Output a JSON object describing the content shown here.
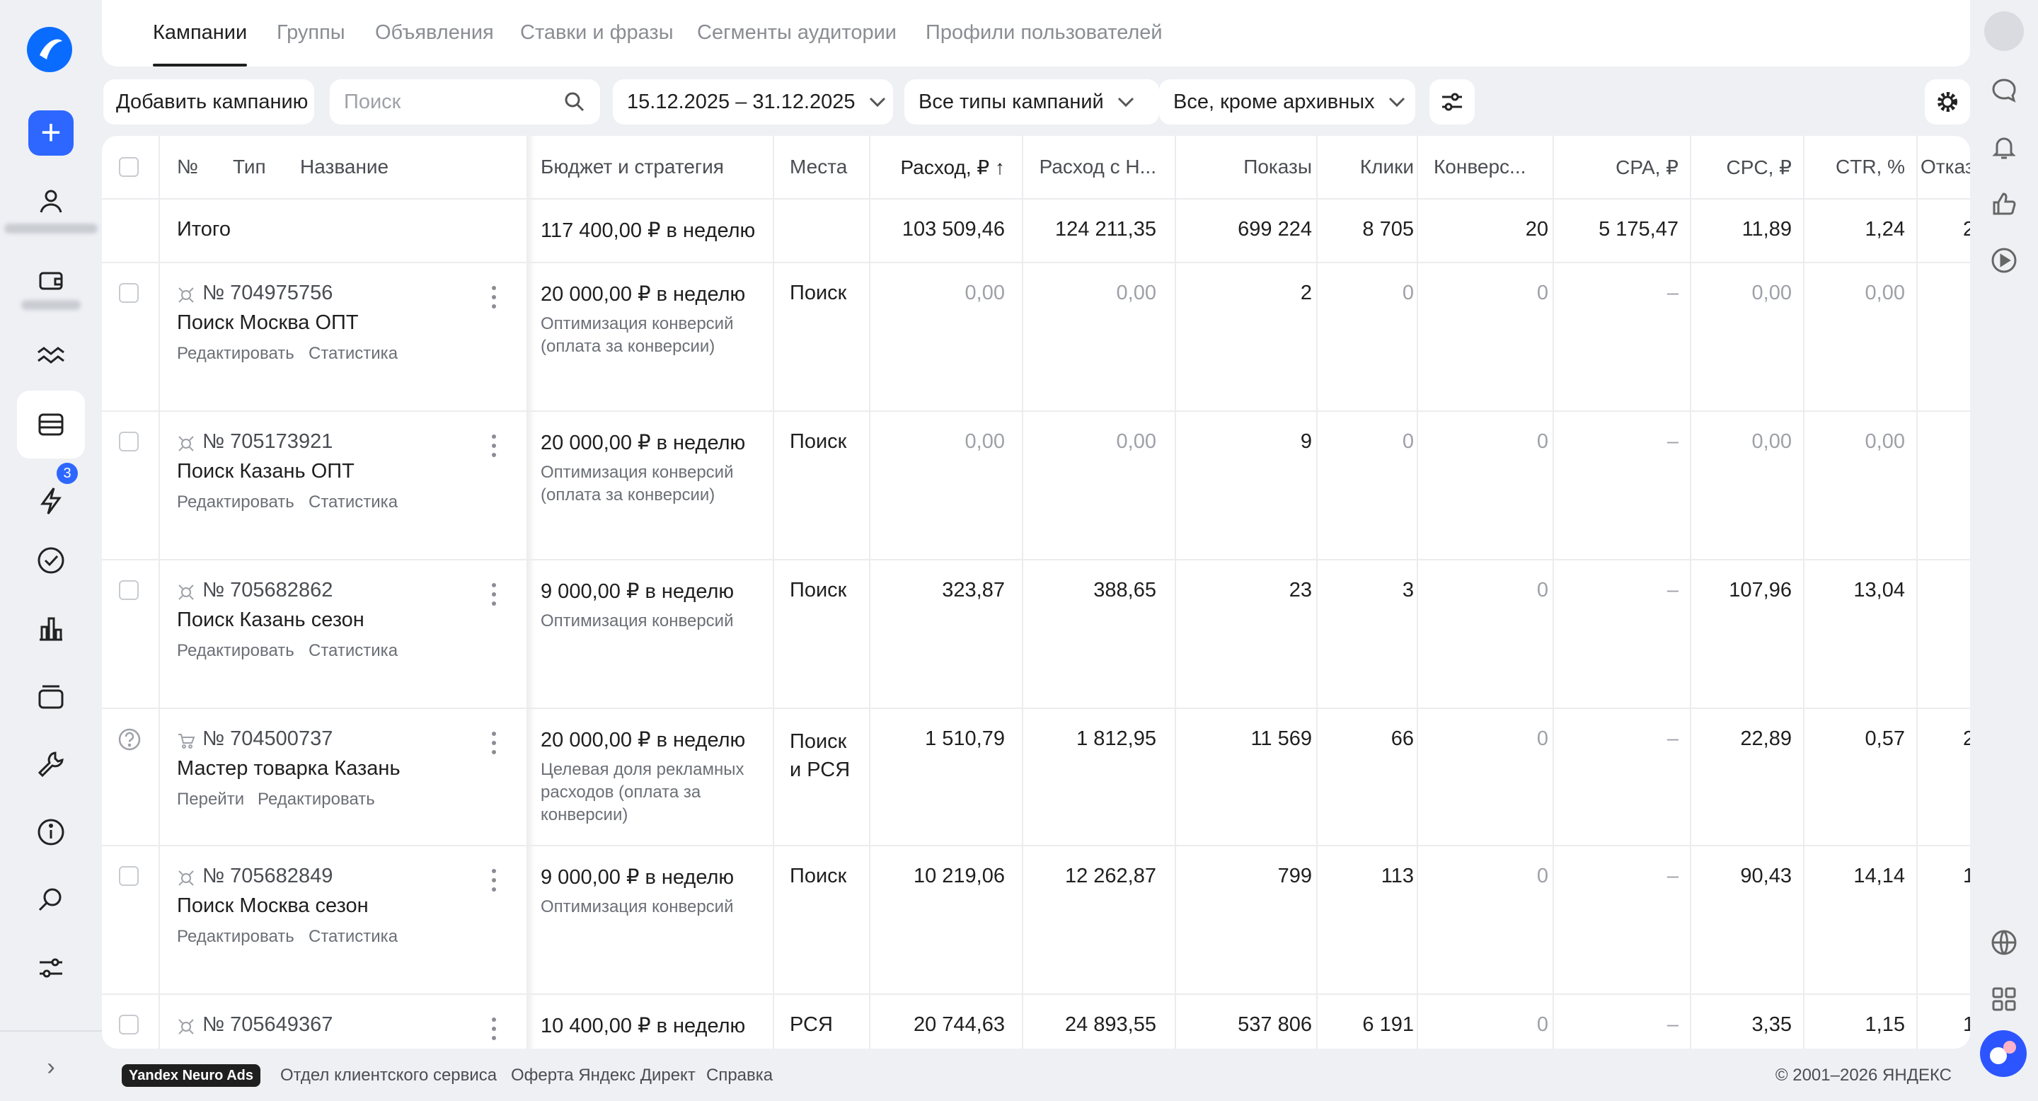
{
  "nav": {
    "tabs": [
      {
        "label": "Кампании",
        "active": true
      },
      {
        "label": "Группы"
      },
      {
        "label": "Объявления"
      },
      {
        "label": "Ставки и фразы"
      },
      {
        "label": "Сегменты аудитории"
      },
      {
        "label": "Профили пользователей"
      }
    ],
    "badge_count": "3"
  },
  "toolbar": {
    "add_label": "Добавить кампанию",
    "search_placeholder": "Поиск",
    "date_range": "15.12.2025 – 31.12.2025",
    "type_filter": "Все типы кампаний",
    "archive_filter": "Все, кроме архивных"
  },
  "table": {
    "headers": {
      "no": "№",
      "type": "Тип",
      "name": "Название",
      "budget": "Бюджет и стратегия",
      "places": "Места",
      "spend": "Расход, ₽ ↑",
      "spend_vat": "Расход с Н...",
      "impressions": "Показы",
      "clicks": "Клики",
      "conversions": "Конверс...",
      "cpa": "CPA, ₽",
      "cpc": "CPC, ₽",
      "ctr": "CTR, %",
      "bounce": "Отказ"
    },
    "total": {
      "label": "Итого",
      "budget": "117 400,00 ₽ в неделю",
      "spend": "103 509,46",
      "spend_vat": "124 211,35",
      "impressions": "699 224",
      "clicks": "8 705",
      "conversions": "20",
      "cpa": "5 175,47",
      "cpc": "11,89",
      "ctr": "1,24",
      "bounce": "2"
    },
    "rows": [
      {
        "id": "№ 704975756",
        "name": "Поиск Москва ОПТ",
        "link1": "Редактировать",
        "link2": "Статистика",
        "budget": "20 000,00 ₽ в неделю",
        "strategy": "Оптимизация конверсий (оплата за конверсии)",
        "places": "Поиск",
        "spend": "0,00",
        "spend_vat": "0,00",
        "impressions": "2",
        "clicks": "0",
        "conversions": "0",
        "cpa": "–",
        "cpc": "0,00",
        "ctr": "0,00",
        "bounce": ""
      },
      {
        "id": "№ 705173921",
        "name": "Поиск Казань ОПТ",
        "link1": "Редактировать",
        "link2": "Статистика",
        "budget": "20 000,00 ₽ в неделю",
        "strategy": "Оптимизация конверсий (оплата за конверсии)",
        "places": "Поиск",
        "spend": "0,00",
        "spend_vat": "0,00",
        "impressions": "9",
        "clicks": "0",
        "conversions": "0",
        "cpa": "–",
        "cpc": "0,00",
        "ctr": "0,00",
        "bounce": ""
      },
      {
        "id": "№ 705682862",
        "name": "Поиск Казань сезон",
        "link1": "Редактировать",
        "link2": "Статистика",
        "budget": "9 000,00 ₽ в неделю",
        "strategy": "Оптимизация конверсий",
        "places": "Поиск",
        "spend": "323,87",
        "spend_vat": "388,65",
        "impressions": "23",
        "clicks": "3",
        "conversions": "0",
        "cpa": "–",
        "cpc": "107,96",
        "ctr": "13,04",
        "bounce": ""
      },
      {
        "id": "№ 704500737",
        "name": "Мастер товарка Казань",
        "link1": "Перейти",
        "link2": "Редактировать",
        "budget": "20 000,00 ₽ в неделю",
        "strategy": "Целевая доля рекламных расходов (оплата за конверсии)",
        "places": "Поиск и РСЯ",
        "spend": "1 510,79",
        "spend_vat": "1 812,95",
        "impressions": "11 569",
        "clicks": "66",
        "conversions": "0",
        "cpa": "–",
        "cpc": "22,89",
        "ctr": "0,57",
        "bounce": "2"
      },
      {
        "id": "№ 705682849",
        "name": "Поиск Москва сезон",
        "link1": "Редактировать",
        "link2": "Статистика",
        "budget": "9 000,00 ₽ в неделю",
        "strategy": "Оптимизация конверсий",
        "places": "Поиск",
        "spend": "10 219,06",
        "spend_vat": "12 262,87",
        "impressions": "799",
        "clicks": "113",
        "conversions": "0",
        "cpa": "–",
        "cpc": "90,43",
        "ctr": "14,14",
        "bounce": "1"
      },
      {
        "id": "№ 705649367",
        "name": "",
        "link1": "",
        "link2": "",
        "budget": "10 400,00 ₽ в неделю",
        "strategy": "",
        "places": "РСЯ",
        "spend": "20 744,63",
        "spend_vat": "24 893,55",
        "impressions": "537 806",
        "clicks": "6 191",
        "conversions": "0",
        "cpa": "–",
        "cpc": "3,35",
        "ctr": "1,15",
        "bounce": "1"
      }
    ]
  },
  "footer": {
    "neuro": "Yandex Neuro Ads",
    "link1": "Отдел клиентского сервиса",
    "link2": "Оферта Яндекс Директ",
    "link3": "Справка",
    "copyright": "© 2001–2026 ЯНДЕКС"
  }
}
